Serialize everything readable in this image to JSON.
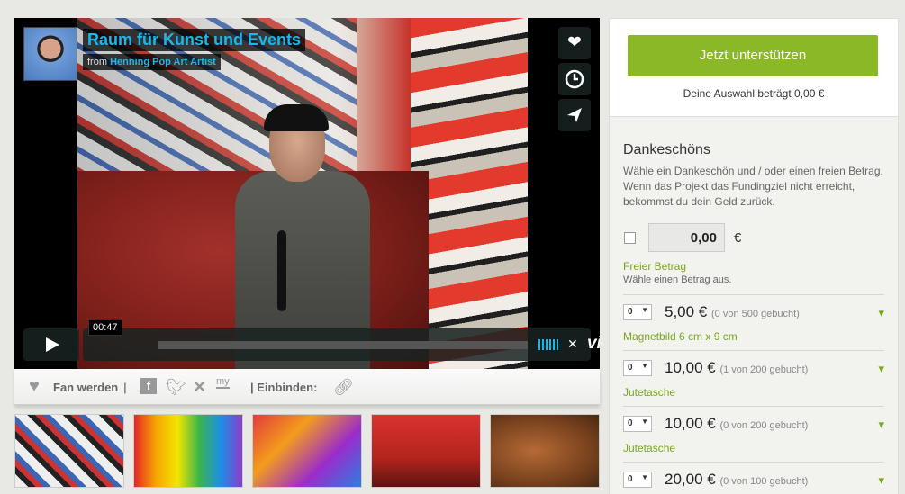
{
  "video": {
    "title": "Raum für Kunst und Events",
    "from_prefix": "from",
    "author": "Henning Pop Art Artist",
    "timecode": "00:47",
    "brand": "vimeo",
    "side_icons": [
      "heart-icon",
      "clock-icon",
      "send-icon"
    ]
  },
  "share_bar": {
    "fan_label": "Fan werden",
    "separator": "|",
    "embed_label": "| Einbinden:",
    "icons": [
      "facebook-icon",
      "twitter-icon",
      "xing-icon",
      "myspace-icon",
      "link-icon"
    ]
  },
  "sidebar": {
    "support_button": "Jetzt unterstützen",
    "selection_text": "Deine Auswahl beträgt 0,00 €",
    "thanks_title": "Dankeschöns",
    "thanks_desc": "Wähle ein Dankeschön und / oder einen freien Betrag. Wenn das Projekt das Fundingziel nicht erreicht, bekommst du dein Geld zurück.",
    "free_amount_value": "0,00",
    "currency": "€",
    "free_amount_label": "Freier Betrag",
    "free_amount_desc": "Wähle einen Betrag aus.",
    "tiers": [
      {
        "qty": "0",
        "price": "5,00 €",
        "booked": "(0 von 500 gebucht)",
        "name": "Magnetbild 6 cm x 9 cm"
      },
      {
        "qty": "0",
        "price": "10,00 €",
        "booked": "(1 von 200 gebucht)",
        "name": "Jutetasche"
      },
      {
        "qty": "0",
        "price": "10,00 €",
        "booked": "(0 von 200 gebucht)",
        "name": "Jutetasche"
      },
      {
        "qty": "0",
        "price": "20,00 €",
        "booked": "(0 von 100 gebucht)",
        "name": ""
      }
    ]
  },
  "colors": {
    "accent_green": "#8ab827",
    "vimeo_blue": "#1ab7ea"
  }
}
